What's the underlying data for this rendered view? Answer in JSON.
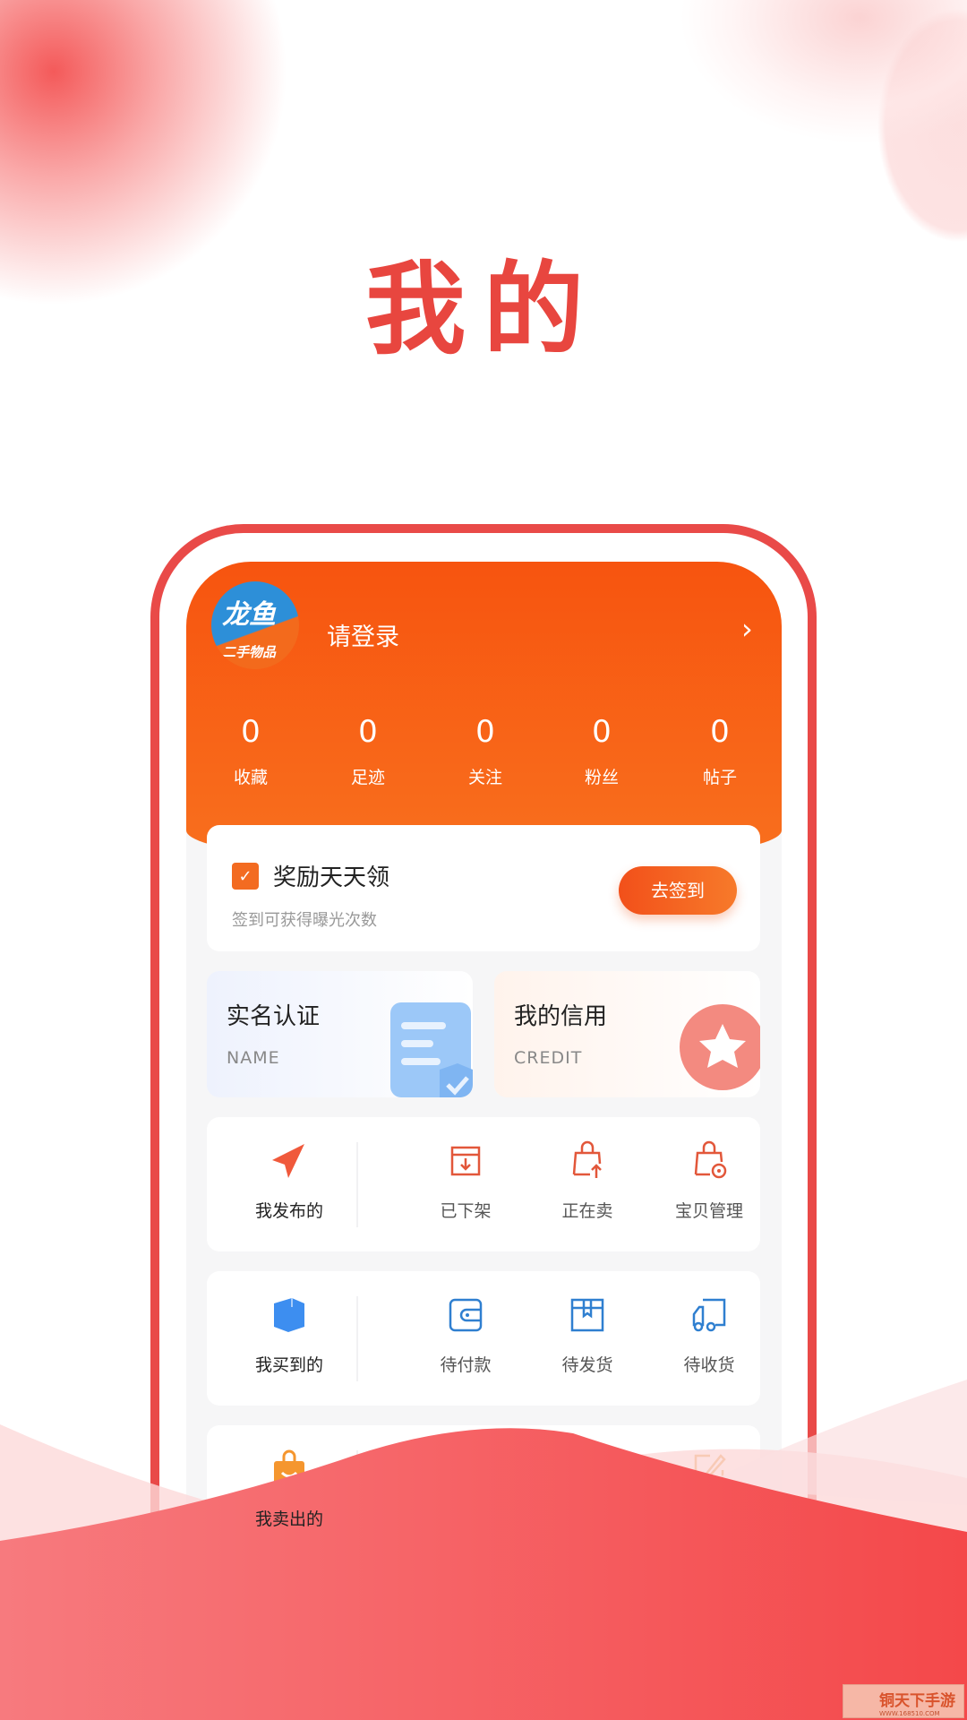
{
  "page_title": "我的",
  "profile": {
    "logo_text": "龙鱼",
    "logo_sub": "二手物品",
    "login": "请登录",
    "chevron": "›"
  },
  "stats": [
    {
      "value": "0",
      "label": "收藏"
    },
    {
      "value": "0",
      "label": "足迹"
    },
    {
      "value": "0",
      "label": "关注"
    },
    {
      "value": "0",
      "label": "粉丝"
    },
    {
      "value": "0",
      "label": "帖子"
    }
  ],
  "signin": {
    "title": "奖励天天领",
    "subtitle": "签到可获得曝光次数",
    "button": "去签到"
  },
  "cert": [
    {
      "title": "实名认证",
      "sub": "NAME"
    },
    {
      "title": "我的信用",
      "sub": "CREDIT"
    }
  ],
  "grids": [
    {
      "items": [
        {
          "label": "我发布的",
          "icon": "paper-plane-icon"
        },
        {
          "label": "已下架",
          "icon": "box-down-icon"
        },
        {
          "label": "正在卖",
          "icon": "bag-up-icon"
        },
        {
          "label": "宝贝管理",
          "icon": "bag-gear-icon"
        }
      ]
    },
    {
      "items": [
        {
          "label": "我买到的",
          "icon": "cube-icon"
        },
        {
          "label": "待付款",
          "icon": "wallet-icon"
        },
        {
          "label": "待发货",
          "icon": "package-icon"
        },
        {
          "label": "待收货",
          "icon": "truck-icon"
        }
      ]
    },
    {
      "items": [
        {
          "label": "我卖出的",
          "icon": "shopping-bag-icon"
        },
        {
          "label": "",
          "icon": "yuan-coin-icon"
        },
        {
          "label": "",
          "icon": "phone-icon"
        },
        {
          "label": "",
          "icon": "edit-icon"
        }
      ]
    }
  ],
  "watermark": {
    "text": "铜天下手游",
    "url": "WWW.168510.COM"
  },
  "colors": {
    "accent": "#f7540f",
    "frame": "#e94a48",
    "wave": "#f55a5a"
  }
}
